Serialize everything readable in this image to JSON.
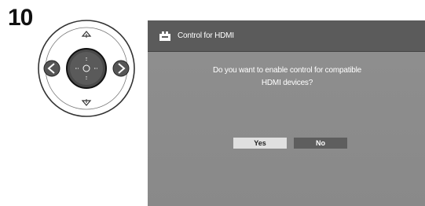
{
  "step": {
    "number": "10"
  },
  "remote": {
    "up_icon": "triangle-up-icon",
    "down_icon": "triangle-down-icon",
    "left_icon": "arrow-left-icon",
    "right_icon": "arrow-right-icon",
    "center_icon": "ok-crosshair-icon"
  },
  "dialog": {
    "title_icon": "connector-icon",
    "title": "Control for HDMI",
    "message_line1": "Do you want to enable control for compatible",
    "message_line2": "HDMI devices?",
    "yes_label": "Yes",
    "no_label": "No",
    "selected": "Yes"
  },
  "colors": {
    "screen_bg": "#8c8c8c",
    "titlebar_bg": "#5b5b5b",
    "selected_button": "#e0e0e0",
    "unselected_button": "#5e5e5e"
  }
}
